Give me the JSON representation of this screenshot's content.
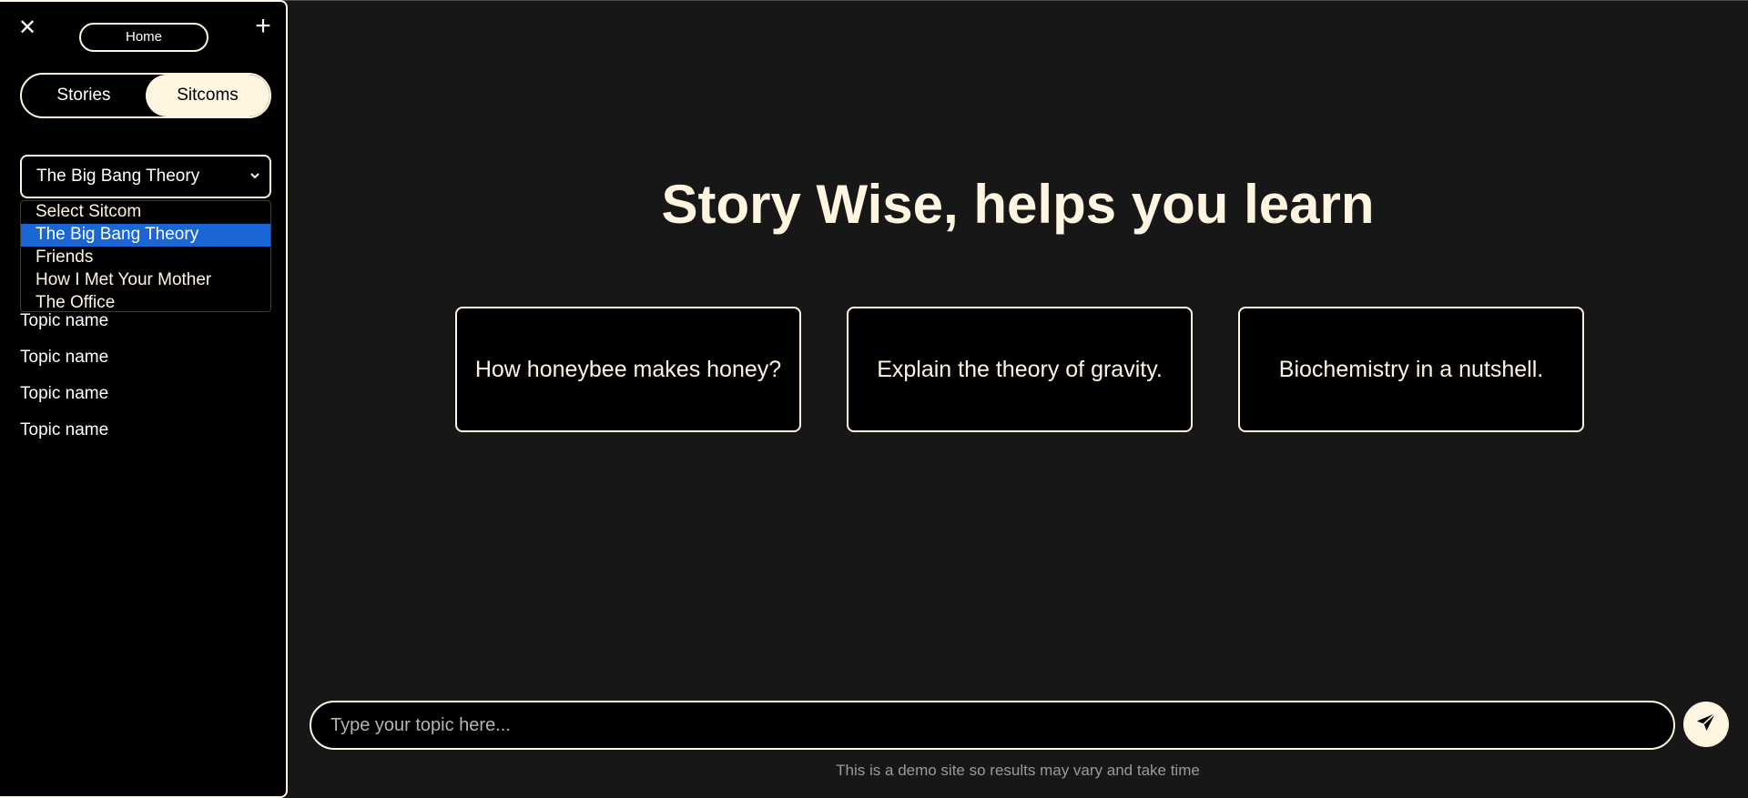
{
  "sidebar": {
    "home_label": "Home",
    "close_icon": "close-icon",
    "add_icon": "plus-icon",
    "toggle": {
      "left": "Stories",
      "right": "Sitcoms",
      "active": "Sitcoms"
    },
    "select": {
      "value": "The Big Bang Theory",
      "options": [
        "Select Sitcom",
        "The Big Bang Theory",
        "Friends",
        "How I Met Your Mother",
        "The Office"
      ],
      "highlighted": "The Big Bang Theory"
    },
    "topics": [
      "Topic name",
      "Topic name",
      "Topic name",
      "Topic name"
    ]
  },
  "main": {
    "headline": "Story Wise, helps you learn",
    "cards": [
      "How honeybee makes honey?",
      "Explain the theory of gravity.",
      "Biochemistry in a nutshell."
    ],
    "input_placeholder": "Type your topic here...",
    "send_icon": "send-icon",
    "disclaimer": "This is a demo site so results may vary and take time"
  },
  "colors": {
    "cream": "#fff5e0",
    "background": "#171717",
    "panel": "#000000",
    "highlight": "#1a66d4"
  }
}
